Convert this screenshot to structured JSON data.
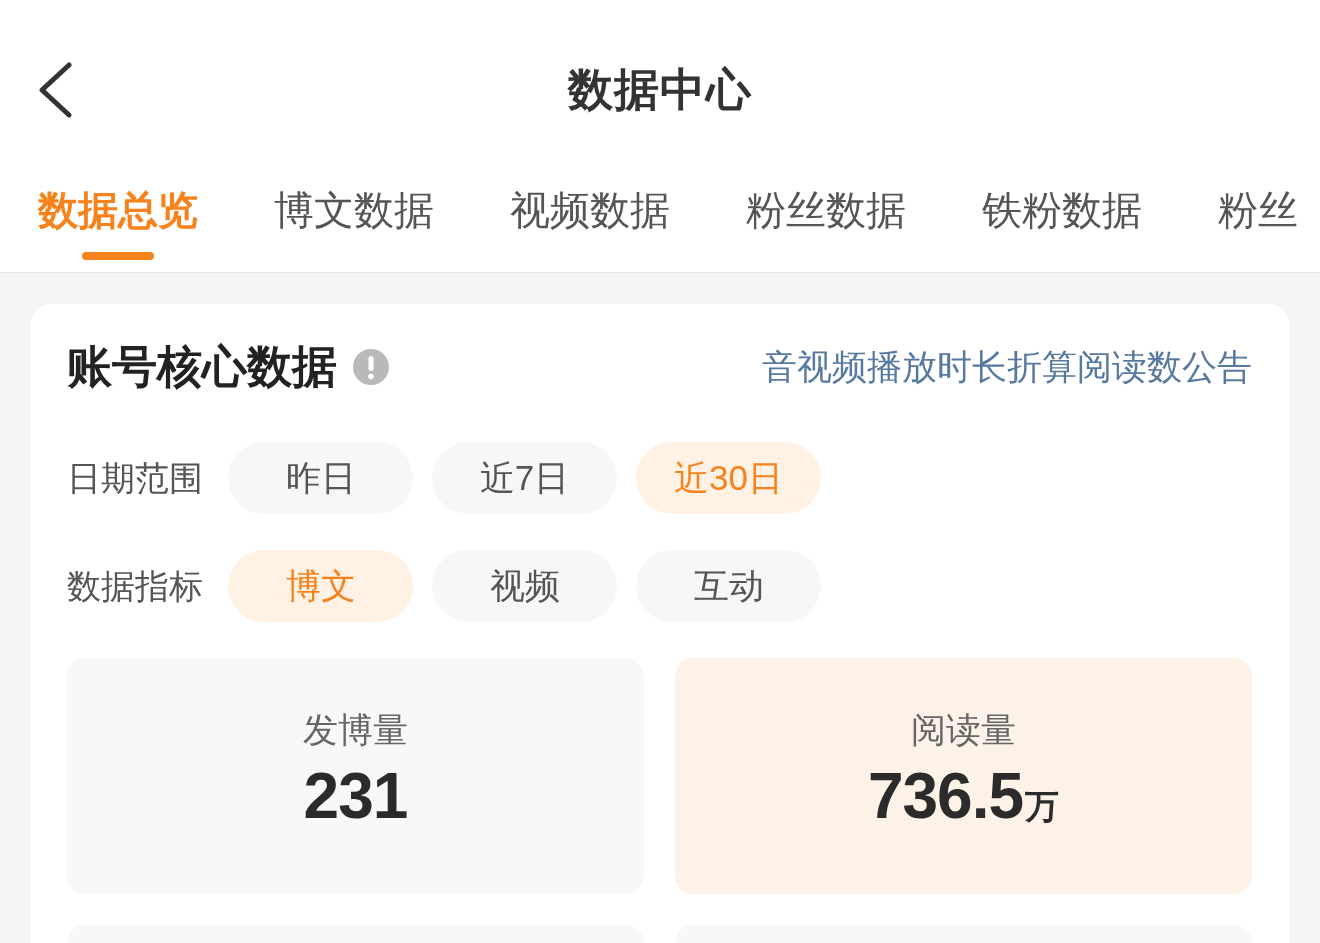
{
  "header": {
    "title": "数据中心"
  },
  "tabs": [
    {
      "label": "数据总览",
      "selected": true
    },
    {
      "label": "博文数据",
      "selected": false
    },
    {
      "label": "视频数据",
      "selected": false
    },
    {
      "label": "粉丝数据",
      "selected": false
    },
    {
      "label": "铁粉数据",
      "selected": false
    },
    {
      "label": "粉丝",
      "selected": false
    }
  ],
  "card": {
    "title": "账号核心数据",
    "notice_link": "音视频播放时长折算阅读数公告",
    "filters": [
      {
        "label": "日期范围",
        "options": [
          {
            "label": "昨日",
            "selected": false
          },
          {
            "label": "近7日",
            "selected": false
          },
          {
            "label": "近30日",
            "selected": true
          }
        ]
      },
      {
        "label": "数据指标",
        "options": [
          {
            "label": "博文",
            "selected": true
          },
          {
            "label": "视频",
            "selected": false
          },
          {
            "label": "互动",
            "selected": false
          }
        ]
      }
    ],
    "stats": [
      {
        "label": "发博量",
        "value": "231",
        "selected": false
      },
      {
        "label": "阅读量",
        "value": "736.5",
        "unit": "万",
        "selected": true
      }
    ]
  }
}
